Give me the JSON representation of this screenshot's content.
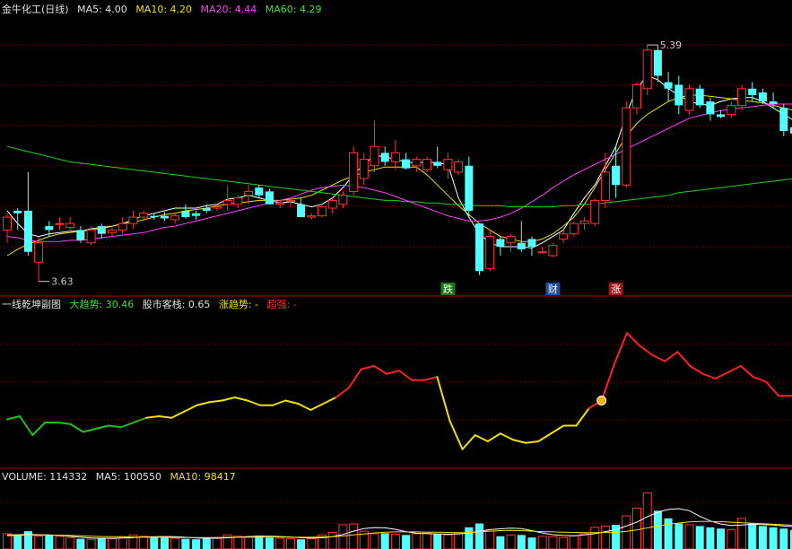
{
  "main": {
    "title": "金牛化工(日线)",
    "ma5": "MA5: 4.00",
    "ma10": "MA10: 4.20",
    "ma20": "MA20: 4.44",
    "ma60": "MA60: 4.29",
    "high_label": "5.39",
    "low_label": "3.63",
    "signals": [
      "跌",
      "财",
      "涨"
    ]
  },
  "indicator": {
    "name": "一线乾坤副图",
    "trend": "大趋势: 30.46",
    "stack": "股市客栈: 0.65",
    "rise": "涨趋势: -",
    "strong": "超强: -"
  },
  "volume": {
    "vol": "VOLUME: 114332",
    "ma5": "MA5: 100550",
    "ma10": "MA10: 98417"
  },
  "colors": {
    "up": "#ff3232",
    "down": "#54ffff",
    "ma5": "#ffffff",
    "ma10": "#f0e000",
    "ma20": "#ff40ff",
    "ma60": "#20d020",
    "grid": "#800000"
  },
  "chart_data": [
    {
      "type": "candlestick",
      "ohlc": [
        [
          3.95,
          4.08,
          3.85,
          4.05
        ],
        [
          4.1,
          4.12,
          3.95,
          4.08
        ],
        [
          4.1,
          4.4,
          3.75,
          3.78
        ],
        [
          3.7,
          3.9,
          3.55,
          3.85
        ],
        [
          3.98,
          4.02,
          3.9,
          3.95
        ],
        [
          4.0,
          4.05,
          3.95,
          4.0
        ],
        [
          3.97,
          4.05,
          3.93,
          4.0
        ],
        [
          3.95,
          3.98,
          3.85,
          3.87
        ],
        [
          3.85,
          3.98,
          3.83,
          3.95
        ],
        [
          3.98,
          4.0,
          3.88,
          3.92
        ],
        [
          3.93,
          3.97,
          3.9,
          3.95
        ],
        [
          3.95,
          4.05,
          3.92,
          4.0
        ],
        [
          4.0,
          4.1,
          3.96,
          4.05
        ],
        [
          4.05,
          4.1,
          4.02,
          4.08
        ],
        [
          4.06,
          4.08,
          4.03,
          4.05
        ],
        [
          4.06,
          4.09,
          4.02,
          4.04
        ],
        [
          4.03,
          4.08,
          4.0,
          4.06
        ],
        [
          4.1,
          4.15,
          4.04,
          4.05
        ],
        [
          4.08,
          4.1,
          4.03,
          4.06
        ],
        [
          4.12,
          4.15,
          4.08,
          4.1
        ],
        [
          4.12,
          4.15,
          4.1,
          4.13
        ],
        [
          4.15,
          4.3,
          4.1,
          4.18
        ],
        [
          4.15,
          4.22,
          4.12,
          4.2
        ],
        [
          4.22,
          4.3,
          4.15,
          4.25
        ],
        [
          4.28,
          4.3,
          4.2,
          4.22
        ],
        [
          4.25,
          4.27,
          4.18,
          4.15
        ],
        [
          4.15,
          4.18,
          4.12,
          4.16
        ],
        [
          4.18,
          4.2,
          4.13,
          4.18
        ],
        [
          4.15,
          4.2,
          4.05,
          4.05
        ],
        [
          4.05,
          4.08,
          4.03,
          4.06
        ],
        [
          4.06,
          4.14,
          4.05,
          4.13
        ],
        [
          4.12,
          4.2,
          4.08,
          4.18
        ],
        [
          4.15,
          4.25,
          4.12,
          4.22
        ],
        [
          4.25,
          4.6,
          4.22,
          4.55
        ],
        [
          4.35,
          4.55,
          4.3,
          4.5
        ],
        [
          4.45,
          4.8,
          4.4,
          4.6
        ],
        [
          4.55,
          4.6,
          4.45,
          4.48
        ],
        [
          4.48,
          4.65,
          4.42,
          4.55
        ],
        [
          4.5,
          4.55,
          4.42,
          4.43
        ],
        [
          4.45,
          4.52,
          4.4,
          4.5
        ],
        [
          4.42,
          4.52,
          4.4,
          4.5
        ],
        [
          4.48,
          4.6,
          4.43,
          4.45
        ],
        [
          4.42,
          4.55,
          4.35,
          4.5
        ],
        [
          4.4,
          4.5,
          4.38,
          4.48
        ],
        [
          4.45,
          4.52,
          4.05,
          4.1
        ],
        [
          4.0,
          4.0,
          3.6,
          3.63
        ],
        [
          3.65,
          3.95,
          3.63,
          3.9
        ],
        [
          3.88,
          3.9,
          3.75,
          3.82
        ],
        [
          3.85,
          3.92,
          3.78,
          3.9
        ],
        [
          3.85,
          4.02,
          3.78,
          3.8
        ],
        [
          3.88,
          3.9,
          3.75,
          3.82
        ],
        [
          3.78,
          3.82,
          3.76,
          3.78
        ],
        [
          3.75,
          3.85,
          3.74,
          3.83
        ],
        [
          3.88,
          3.95,
          3.85,
          3.92
        ],
        [
          3.92,
          4.02,
          3.9,
          4.0
        ],
        [
          4.0,
          4.05,
          3.95,
          4.02
        ],
        [
          4.0,
          4.2,
          3.98,
          4.18
        ],
        [
          4.18,
          4.55,
          4.12,
          4.4
        ],
        [
          4.45,
          4.6,
          4.2,
          4.3
        ],
        [
          4.3,
          4.95,
          4.28,
          4.9
        ],
        [
          4.9,
          5.1,
          4.85,
          5.08
        ],
        [
          5.05,
          5.39,
          5.0,
          5.35
        ],
        [
          5.35,
          5.39,
          5.1,
          5.15
        ],
        [
          5.1,
          5.18,
          4.95,
          5.05
        ],
        [
          5.08,
          5.15,
          4.85,
          4.92
        ],
        [
          4.88,
          5.08,
          4.85,
          5.05
        ],
        [
          5.05,
          5.08,
          4.9,
          4.92
        ],
        [
          4.95,
          4.98,
          4.8,
          4.85
        ],
        [
          4.85,
          4.88,
          4.82,
          4.83
        ],
        [
          4.85,
          4.95,
          4.82,
          4.92
        ],
        [
          4.92,
          5.08,
          4.88,
          5.05
        ],
        [
          5.05,
          5.1,
          4.95,
          5.0
        ],
        [
          5.02,
          5.05,
          4.93,
          4.95
        ],
        [
          4.95,
          5.02,
          4.9,
          4.93
        ],
        [
          4.9,
          4.93,
          4.68,
          4.72
        ],
        [
          4.75,
          4.78,
          4.68,
          4.7
        ]
      ],
      "ma": {
        "MA5": [
          4.1,
          4.0,
          3.92,
          3.9,
          3.92,
          3.93,
          3.94,
          3.94,
          3.96,
          3.97,
          3.98,
          4.0,
          4.03,
          4.06,
          4.08,
          4.1,
          4.12,
          4.12,
          4.12,
          4.14,
          4.15,
          4.19,
          4.2,
          4.22,
          4.2,
          4.18,
          4.16,
          4.17,
          4.15,
          4.13,
          4.15,
          4.2,
          4.28,
          4.38,
          4.46,
          4.53,
          4.52,
          4.5,
          4.48,
          4.47,
          4.48,
          4.47,
          4.46,
          4.2,
          4.05,
          3.92,
          3.85,
          3.82,
          3.82,
          3.82,
          3.81,
          3.85,
          3.9,
          3.95,
          4.08,
          4.2,
          4.3,
          4.45,
          4.6,
          4.85,
          5.05,
          5.15,
          5.12,
          5.05,
          5.0,
          4.95,
          4.93,
          4.92,
          4.95,
          4.97,
          4.98,
          4.98,
          4.95,
          4.9,
          4.85,
          4.8
        ],
        "MA10": [
          3.75,
          3.8,
          3.84,
          3.87,
          3.9,
          3.92,
          3.93,
          3.94,
          3.95,
          3.96,
          3.98,
          4.0,
          4.01,
          4.03,
          4.05,
          4.07,
          4.08,
          4.1,
          4.11,
          4.12,
          4.14,
          4.15,
          4.16,
          4.17,
          4.18,
          4.18,
          4.18,
          4.19,
          4.2,
          4.22,
          4.26,
          4.3,
          4.34,
          4.37,
          4.4,
          4.42,
          4.44,
          4.44,
          4.44,
          4.44,
          4.38,
          4.3,
          4.22,
          4.14,
          4.07,
          4.0,
          3.95,
          3.9,
          3.88,
          3.86,
          3.86,
          3.88,
          3.92,
          3.98,
          4.05,
          4.15,
          4.28,
          4.42,
          4.55,
          4.68,
          4.78,
          4.85,
          4.9,
          4.95,
          4.98,
          5.0,
          5.0,
          4.99,
          4.98,
          4.97,
          4.96,
          4.95,
          4.94,
          4.92,
          4.9,
          4.88
        ],
        "MA20": [
          3.9,
          3.89,
          3.87,
          3.86,
          3.86,
          3.86,
          3.87,
          3.87,
          3.88,
          3.89,
          3.9,
          3.91,
          3.92,
          3.93,
          3.95,
          3.97,
          3.98,
          4.0,
          4.02,
          4.04,
          4.06,
          4.08,
          4.1,
          4.12,
          4.14,
          4.16,
          4.18,
          4.2,
          4.23,
          4.26,
          4.28,
          4.29,
          4.3,
          4.29,
          4.28,
          4.26,
          4.24,
          4.21,
          4.18,
          4.15,
          4.12,
          4.09,
          4.06,
          4.04,
          4.02,
          4.02,
          4.03,
          4.05,
          4.08,
          4.12,
          4.17,
          4.22,
          4.28,
          4.33,
          4.38,
          4.42,
          4.46,
          4.5,
          4.54,
          4.58,
          4.62,
          4.66,
          4.7,
          4.74,
          4.78,
          4.82,
          4.84,
          4.86,
          4.88,
          4.89,
          4.9,
          4.91,
          4.92,
          4.93,
          4.93,
          4.93
        ],
        "MA60": [
          4.6,
          4.58,
          4.56,
          4.54,
          4.52,
          4.5,
          4.48,
          4.47,
          4.46,
          4.45,
          4.44,
          4.43,
          4.42,
          4.41,
          4.4,
          4.39,
          4.38,
          4.37,
          4.36,
          4.35,
          4.34,
          4.33,
          4.32,
          4.31,
          4.3,
          4.29,
          4.28,
          4.27,
          4.26,
          4.25,
          4.24,
          4.23,
          4.22,
          4.21,
          4.2,
          4.19,
          4.18,
          4.18,
          4.17,
          4.17,
          4.16,
          4.16,
          4.15,
          4.15,
          4.14,
          4.14,
          4.14,
          4.14,
          4.13,
          4.13,
          4.13,
          4.13,
          4.13,
          4.14,
          4.14,
          4.15,
          4.15,
          4.16,
          4.17,
          4.18,
          4.19,
          4.2,
          4.21,
          4.22,
          4.24,
          4.25,
          4.26,
          4.27,
          4.28,
          4.29,
          4.3,
          4.31,
          4.32,
          4.33,
          4.34,
          4.35
        ]
      },
      "ylim": [
        3.52,
        5.6
      ]
    },
    {
      "type": "line",
      "name": "一线乾坤副图",
      "values": [
        40,
        42,
        30,
        38,
        38,
        37,
        32,
        34,
        36,
        35,
        38,
        41,
        42,
        41,
        45,
        49,
        51,
        52,
        54,
        52,
        49,
        49,
        52,
        50,
        46,
        50,
        54,
        60,
        72,
        74,
        69,
        71,
        65,
        65,
        67,
        39,
        21,
        30,
        26,
        31,
        27,
        25,
        26,
        31,
        36,
        36,
        47,
        52,
        75,
        95,
        87,
        81,
        77,
        83,
        74,
        69,
        66,
        70,
        74,
        67,
        64,
        55,
        55
      ],
      "ylim": [
        10,
        110
      ]
    },
    {
      "type": "bar",
      "name": "VOLUME",
      "values": [
        60,
        55,
        70,
        50,
        55,
        50,
        45,
        40,
        38,
        42,
        40,
        45,
        55,
        50,
        48,
        45,
        42,
        40,
        38,
        42,
        45,
        55,
        50,
        48,
        52,
        45,
        42,
        40,
        38,
        40,
        55,
        65,
        95,
        98,
        70,
        60,
        62,
        58,
        55,
        60,
        62,
        58,
        55,
        60,
        85,
        100,
        70,
        50,
        55,
        55,
        45,
        50,
        48,
        45,
        52,
        60,
        85,
        90,
        95,
        130,
        160,
        220,
        150,
        120,
        100,
        95,
        90,
        85,
        80,
        75,
        120,
        100,
        90,
        85,
        80,
        75
      ],
      "ma5": [
        55,
        56,
        57,
        56,
        55,
        53,
        50,
        46,
        43,
        42,
        42,
        43,
        45,
        47,
        48,
        49,
        48,
        46,
        43,
        42,
        42,
        44,
        46,
        49,
        50,
        50,
        49,
        47,
        44,
        43,
        44,
        48,
        57,
        70,
        80,
        84,
        83,
        77,
        68,
        62,
        60,
        59,
        58,
        59,
        63,
        70,
        76,
        79,
        82,
        80,
        72,
        63,
        56,
        53,
        52,
        55,
        60,
        68,
        76,
        90,
        105,
        126,
        144,
        155,
        158,
        150,
        128,
        110,
        98,
        92,
        94,
        97,
        96,
        94,
        90,
        88
      ],
      "ma10": [
        52,
        53,
        54,
        54,
        54,
        54,
        53,
        52,
        50,
        49,
        48,
        48,
        47,
        46,
        46,
        46,
        45,
        45,
        45,
        45,
        45,
        46,
        46,
        46,
        47,
        47,
        47,
        46,
        46,
        46,
        47,
        48,
        51,
        55,
        59,
        63,
        66,
        67,
        67,
        67,
        66,
        66,
        65,
        64,
        64,
        67,
        70,
        72,
        73,
        72,
        70,
        68,
        67,
        66,
        65,
        64,
        64,
        65,
        66,
        69,
        75,
        83,
        90,
        97,
        102,
        106,
        108,
        108,
        107,
        105,
        103,
        101,
        99,
        97,
        95,
        93
      ],
      "ylim": [
        0,
        260
      ]
    }
  ]
}
